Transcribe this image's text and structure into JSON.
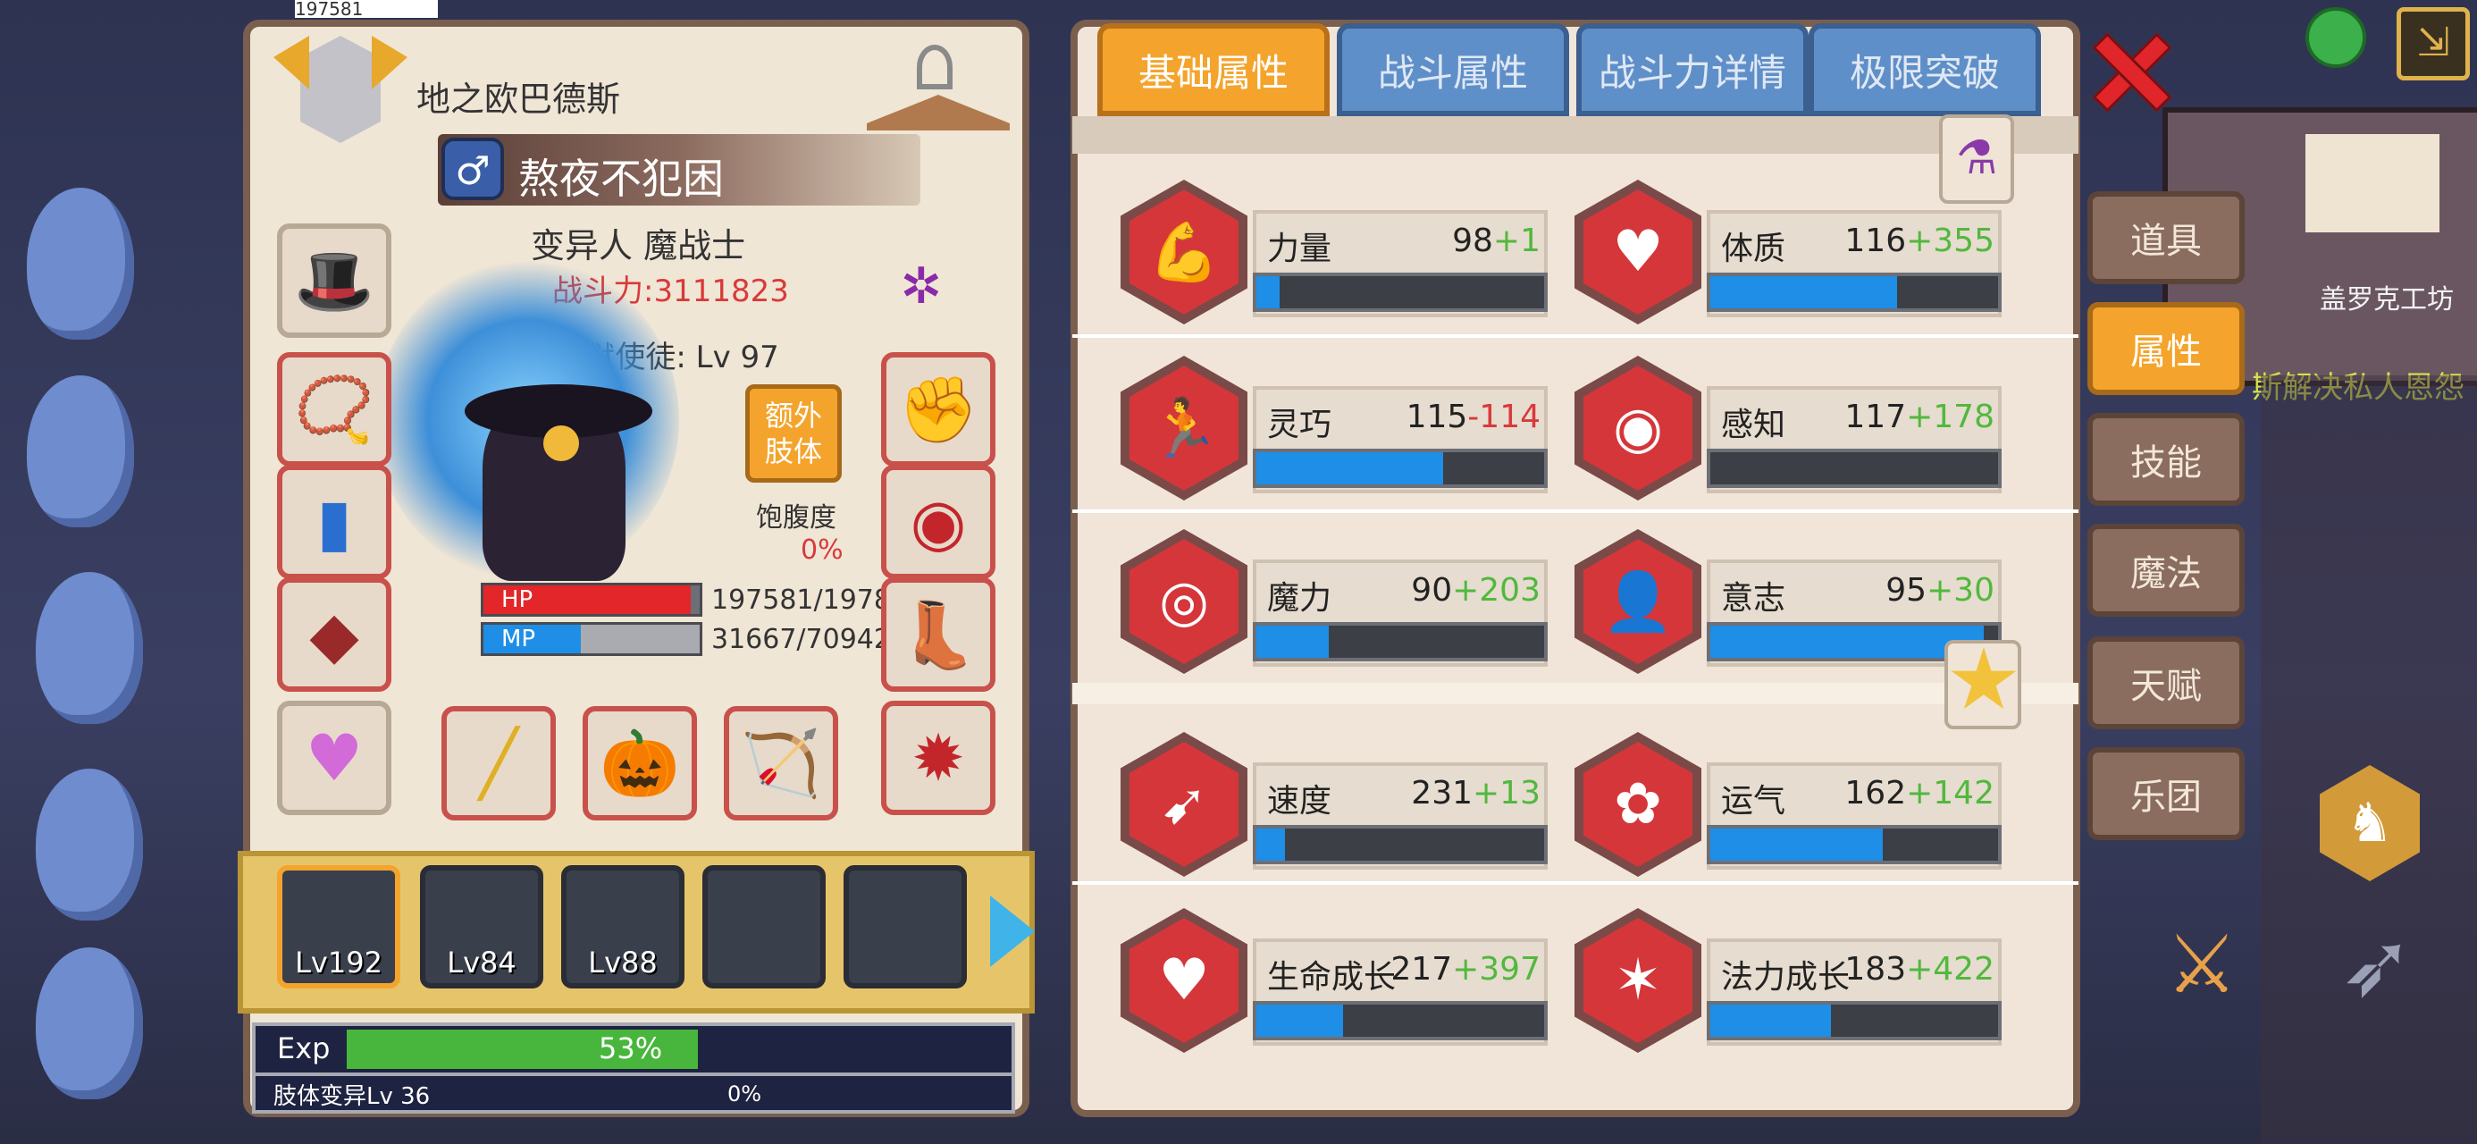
{
  "top_bar": {
    "partial_hp_text": "197581"
  },
  "profile": {
    "title": "地之欧巴德斯",
    "name": "熬夜不犯困",
    "race_class": "变异人 魔战士",
    "combat_power": "战斗力:3111823",
    "rank": "S阶 地狱使徒: Lv 97",
    "extra_limb_label": "额外\n肢体",
    "satiety_label": "饱腹度",
    "satiety_value": "0%",
    "hp_label": "HP",
    "hp_value": "197581/1978",
    "hp_fraction": 0.96,
    "mp_label": "MP",
    "mp_value": "31667/70942",
    "mp_fraction": 0.45
  },
  "party": [
    {
      "level": "Lv192"
    },
    {
      "level": "Lv84"
    },
    {
      "level": "Lv88"
    }
  ],
  "exp": {
    "label": "Exp",
    "percent_text": "53%",
    "fraction": 0.53,
    "limb_label": "肢体变异Lv 36",
    "limb_percent_text": "0%"
  },
  "tabs": [
    {
      "label": "基础属性",
      "active": true
    },
    {
      "label": "战斗属性",
      "active": false
    },
    {
      "label": "战斗力详情",
      "active": false
    },
    {
      "label": "极限突破",
      "active": false
    }
  ],
  "stats": [
    {
      "name": "力量",
      "base": "98",
      "bonus": "+1",
      "sign": "pos",
      "fill": 0.08,
      "icon": "arm-icon"
    },
    {
      "name": "体质",
      "base": "116",
      "bonus": "+355",
      "sign": "pos",
      "fill": 0.65,
      "icon": "body-icon"
    },
    {
      "name": "灵巧",
      "base": "115",
      "bonus": "-114",
      "sign": "neg",
      "fill": 0.65,
      "icon": "runner-icon"
    },
    {
      "name": "感知",
      "base": "117",
      "bonus": "+178",
      "sign": "pos",
      "fill": 0.0,
      "icon": "eye-icon"
    },
    {
      "name": "魔力",
      "base": "90",
      "bonus": "+203",
      "sign": "pos",
      "fill": 0.25,
      "icon": "swirl-icon"
    },
    {
      "name": "意志",
      "base": "95",
      "bonus": "+30",
      "sign": "pos",
      "fill": 0.95,
      "icon": "head-icon"
    },
    {
      "name": "速度",
      "base": "231",
      "bonus": "+13",
      "sign": "pos",
      "fill": 0.1,
      "icon": "wing-icon"
    },
    {
      "name": "运气",
      "base": "162",
      "bonus": "+142",
      "sign": "pos",
      "fill": 0.6,
      "icon": "clover-icon"
    },
    {
      "name": "生命成长",
      "base": "217",
      "bonus": "+397",
      "sign": "pos",
      "fill": 0.3,
      "icon": "heart-icon"
    },
    {
      "name": "法力成长",
      "base": "183",
      "bonus": "+422",
      "sign": "pos",
      "fill": 0.42,
      "icon": "star-rune-icon"
    }
  ],
  "side_menu": [
    {
      "label": "道具",
      "active": false
    },
    {
      "label": "属性",
      "active": true
    },
    {
      "label": "技能",
      "active": false
    },
    {
      "label": "魔法",
      "active": false
    },
    {
      "label": "天赋",
      "active": false
    },
    {
      "label": "乐团",
      "active": false
    }
  ],
  "background": {
    "workshop_label": "盖罗克工坊",
    "quest_text": "斯解决私人恩怨"
  },
  "colors": {
    "accent_tab": "#f4a42c",
    "inactive_tab": "#5f8fc8",
    "stat_icon": "#d5363a",
    "bar_fill": "#1e8ee6",
    "bonus_positive": "#52b83d",
    "bonus_negative": "#d83a3a",
    "hp_bar": "#e3262a",
    "mp_bar": "#1e8ee6",
    "exp_bar": "#48b63c"
  }
}
